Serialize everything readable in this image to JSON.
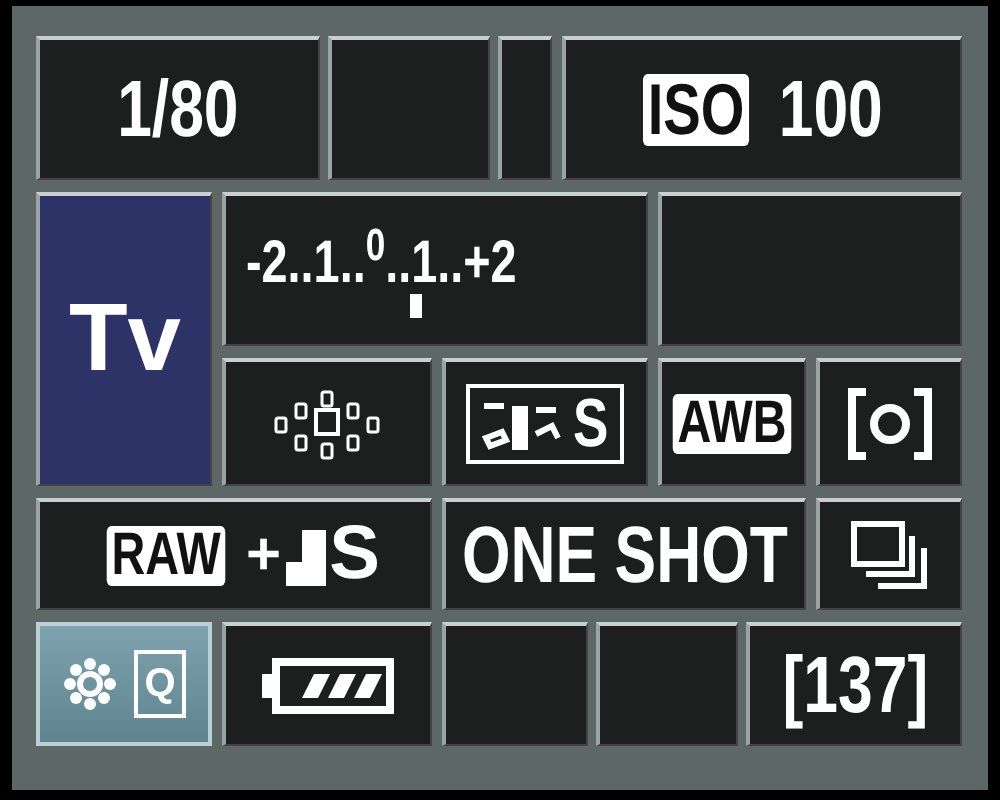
{
  "cells": [
    {
      "kind": "text",
      "text": "1/80"
    },
    {
      "kind": "empty"
    },
    {
      "kind": "empty"
    },
    {
      "kind": "iso",
      "badge": "ISO",
      "value": "100"
    },
    {
      "kind": "mode",
      "text": "Tv"
    },
    {
      "kind": "scale",
      "text": "-2..1..$^{0}$..1..+2"
    },
    {
      "kind": "empty"
    },
    {
      "kind": "af_points"
    },
    {
      "kind": "picture_style",
      "text": "S"
    },
    {
      "kind": "badge",
      "text": "AWB"
    },
    {
      "kind": "metering"
    },
    {
      "kind": "quality",
      "badge": "RAW",
      "plus": "+",
      "size": "S"
    },
    {
      "kind": "text",
      "text": "ONE SHOT"
    },
    {
      "kind": "drive"
    },
    {
      "kind": "quick",
      "text": "Q",
      "selected": true
    },
    {
      "kind": "battery"
    },
    {
      "kind": "empty"
    },
    {
      "kind": "empty"
    },
    {
      "kind": "text",
      "text": "[137]"
    }
  ]
}
